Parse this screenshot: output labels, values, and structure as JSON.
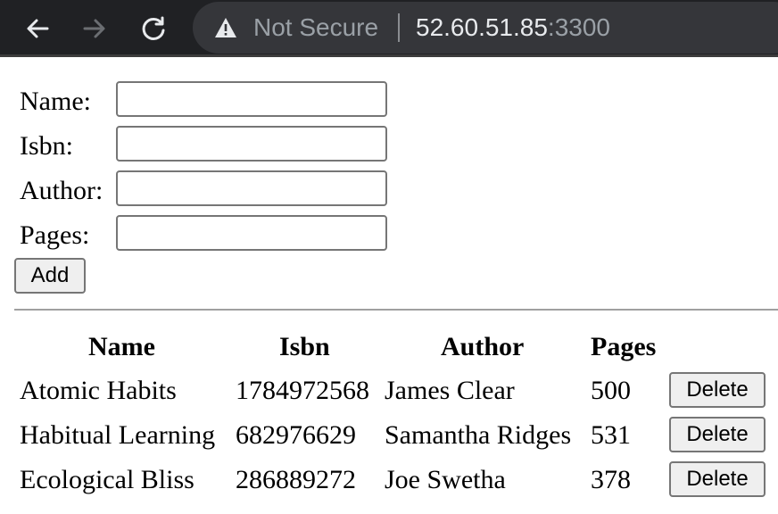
{
  "browser": {
    "security_label": "Not Secure",
    "url_host": "52.60.51.85",
    "url_port": ":3300",
    "icons": {
      "back": "back-arrow-icon",
      "forward": "forward-arrow-icon",
      "reload": "reload-icon",
      "security": "warning-triangle-icon"
    }
  },
  "form": {
    "fields": [
      {
        "label": "Name:",
        "value": ""
      },
      {
        "label": "Isbn:",
        "value": ""
      },
      {
        "label": "Author:",
        "value": ""
      },
      {
        "label": "Pages:",
        "value": ""
      }
    ],
    "add_label": "Add"
  },
  "table": {
    "headers": [
      "Name",
      "Isbn",
      "Author",
      "Pages"
    ],
    "rows": [
      {
        "name": "Atomic Habits",
        "isbn": "1784972568",
        "author": "James Clear",
        "pages": "500",
        "delete_label": "Delete"
      },
      {
        "name": "Habitual Learning",
        "isbn": "682976629",
        "author": "Samantha Ridges",
        "pages": "531",
        "delete_label": "Delete"
      },
      {
        "name": "Ecological Bliss",
        "isbn": "286889272",
        "author": "Joe Swetha",
        "pages": "378",
        "delete_label": "Delete"
      }
    ]
  },
  "colors": {
    "toolbar_bg": "#202124",
    "omnibox_bg": "#35363a",
    "button_bg": "#efefef"
  }
}
